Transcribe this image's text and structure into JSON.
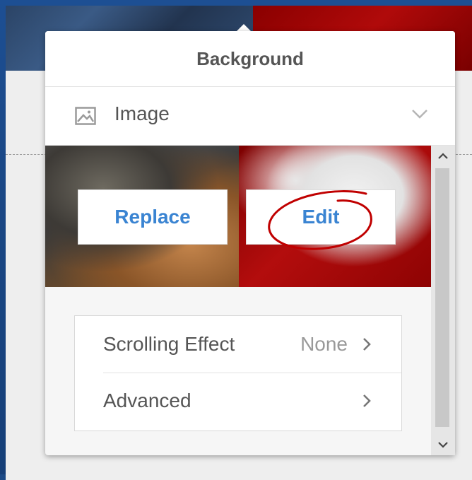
{
  "panel": {
    "title": "Background",
    "type_selector": {
      "icon": "image-icon",
      "label": "Image",
      "chevron": "chevron-down-icon"
    },
    "image_actions": {
      "replace_label": "Replace",
      "edit_label": "Edit"
    },
    "settings": [
      {
        "label": "Scrolling Effect",
        "value": "None",
        "chevron": "chevron-right-icon"
      },
      {
        "label": "Advanced",
        "value": "",
        "chevron": "chevron-right-icon"
      }
    ],
    "scrollbar": {
      "up_icon": "arrow-up-icon",
      "down_icon": "arrow-down-icon"
    }
  },
  "colors": {
    "accent": "#3a84d2",
    "annotation": "#c00000",
    "text": "#555555",
    "muted": "#999999"
  }
}
